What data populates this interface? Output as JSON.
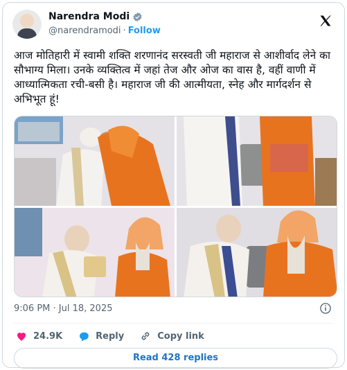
{
  "author": {
    "name": "Narendra Modi",
    "handle": "@narendramodi",
    "separator": "·",
    "follow_label": "Follow"
  },
  "post": {
    "text": "आज मोतिहारी में स्वामी शक्ति शरणानंद सरस्वती जी महाराज से आशीर्वाद लेने का सौभाग्य मिला। उनके व्यक्तित्व में जहां तेज और ओज का वास है, वहीं वाणी में आध्यात्मिकता रची-बसी है। महाराज जी की आत्मीयता, स्नेह और मार्गदर्शन से अभिभूत हूं!",
    "timestamp": "9:06 PM · Jul 18, 2025"
  },
  "actions": {
    "likes": "24.9K",
    "reply_label": "Reply",
    "copy_label": "Copy link"
  },
  "read_replies_label": "Read 428 replies",
  "colors": {
    "accent": "#1d9bf0",
    "like": "#f91880",
    "saffron": "#e8731f"
  }
}
